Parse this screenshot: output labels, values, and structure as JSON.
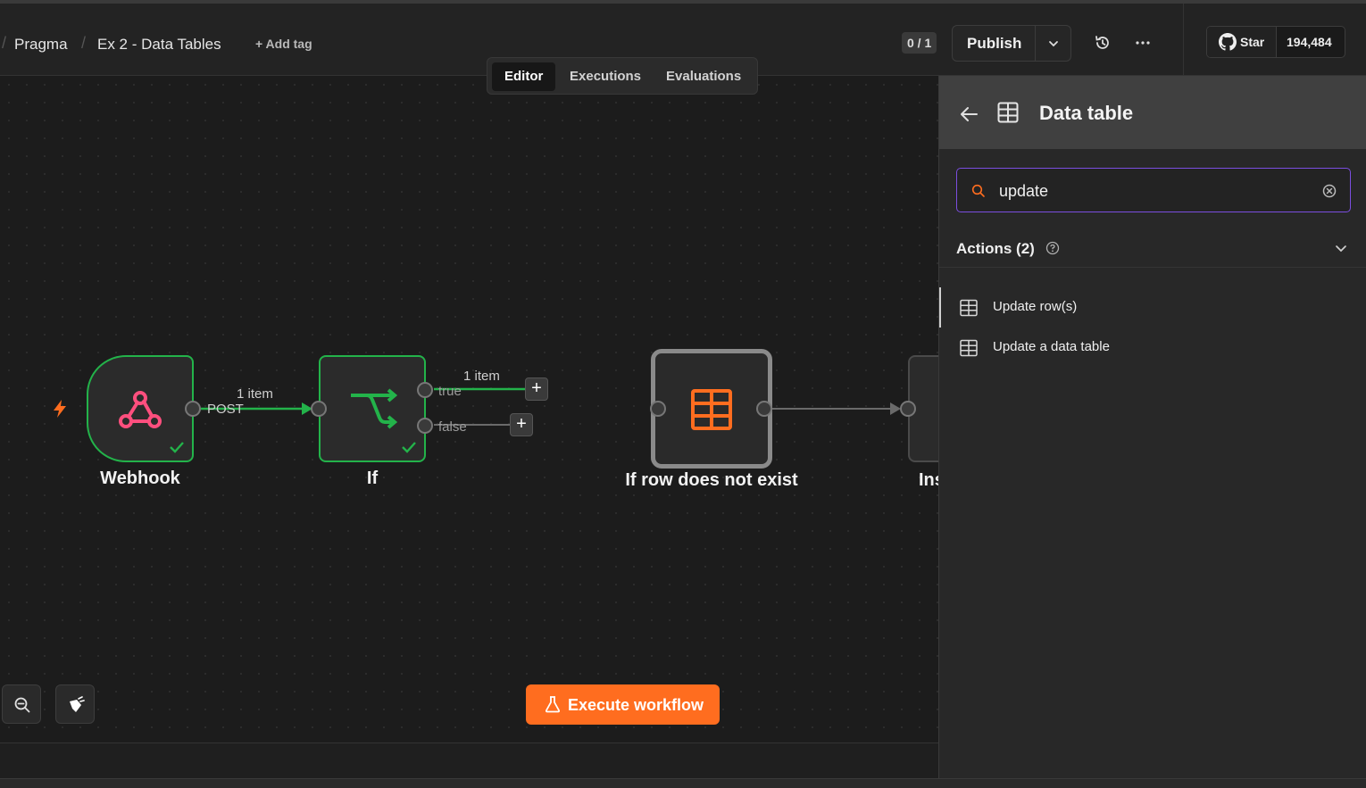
{
  "breadcrumb": {
    "project": "Pragma",
    "workflow": "Ex 2 - Data Tables",
    "add_tag": "+ Add tag"
  },
  "header": {
    "counter": "0 / 1",
    "publish_label": "Publish",
    "github": {
      "star_label": "Star",
      "star_count": "194,484"
    }
  },
  "tabs": [
    {
      "label": "Editor",
      "active": true
    },
    {
      "label": "Executions",
      "active": false
    },
    {
      "label": "Evaluations",
      "active": false
    }
  ],
  "canvas": {
    "nodes": [
      {
        "label": "Webhook",
        "icon": "webhook-icon",
        "status": "success"
      },
      {
        "label": "If",
        "icon": "if-branch-icon",
        "status": "success"
      },
      {
        "label": "If row does not exist",
        "icon": "table-icon"
      },
      {
        "label": "Ins"
      }
    ],
    "edges": {
      "webhook_items": "1 item",
      "webhook_output": "POST",
      "if_true_items": "1 item",
      "if_true": "true",
      "if_false": "false"
    },
    "execute_label": "Execute workflow"
  },
  "panel": {
    "title": "Data table",
    "search": {
      "value": "update"
    },
    "section_title": "Actions (2)",
    "actions": [
      {
        "label": "Update row(s)",
        "icon": "table-icon"
      },
      {
        "label": "Update a data table",
        "icon": "table-icon"
      }
    ]
  },
  "colors": {
    "accent": "#ff6d1f",
    "success": "#23b34a",
    "focus": "#7b4ee0"
  }
}
